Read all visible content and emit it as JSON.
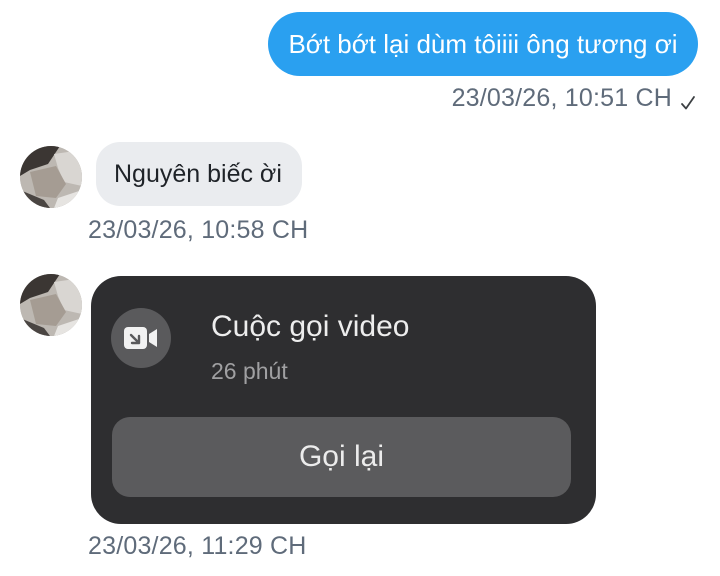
{
  "messages": {
    "outgoing": {
      "text": "Bớt bớt lại dùm tôiiii ông tương ơi",
      "timestamp": "23/03/26, 10:51 CH",
      "status_icon": "check-icon"
    },
    "incoming": {
      "text": "Nguyên biếc ời",
      "timestamp": "23/03/26, 10:58 CH"
    },
    "call": {
      "title": "Cuộc gọi video",
      "duration": "26 phút",
      "button_label": "Gọi lại",
      "timestamp": "23/03/26, 11:29 CH",
      "icon": "video-call-icon"
    }
  },
  "colors": {
    "outgoing_bubble": "#2aa0f0",
    "incoming_bubble": "#eaecef",
    "call_card": "#2e2e30",
    "call_button": "#5b5b5d",
    "timestamp_text": "#5f6b7a"
  }
}
